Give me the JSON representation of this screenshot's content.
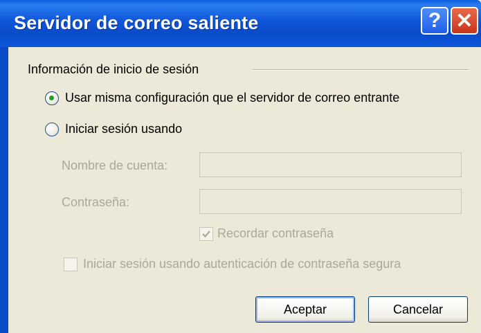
{
  "window": {
    "title": "Servidor de correo saliente",
    "help_glyph": "?",
    "close_glyph": "✕"
  },
  "group": {
    "label": "Información de inicio de sesión"
  },
  "options": {
    "same_config_label": "Usar misma configuración que el servidor de correo entrante",
    "login_using_label": "Iniciar sesión usando",
    "selected": "same_config"
  },
  "fields": {
    "account_label": "Nombre de cuenta:",
    "account_value": "",
    "password_label": "Contraseña:",
    "password_value": ""
  },
  "checkboxes": {
    "remember_label": "Recordar contraseña",
    "remember_checked": true,
    "spa_label": "Iniciar sesión usando autenticación de contraseña segura",
    "spa_checked": false
  },
  "buttons": {
    "ok_label": "Aceptar",
    "cancel_label": "Cancelar"
  },
  "colors": {
    "titlebar": "#0a4bc8",
    "radio_dot": "#21a121",
    "disabled_text": "#aca899"
  }
}
